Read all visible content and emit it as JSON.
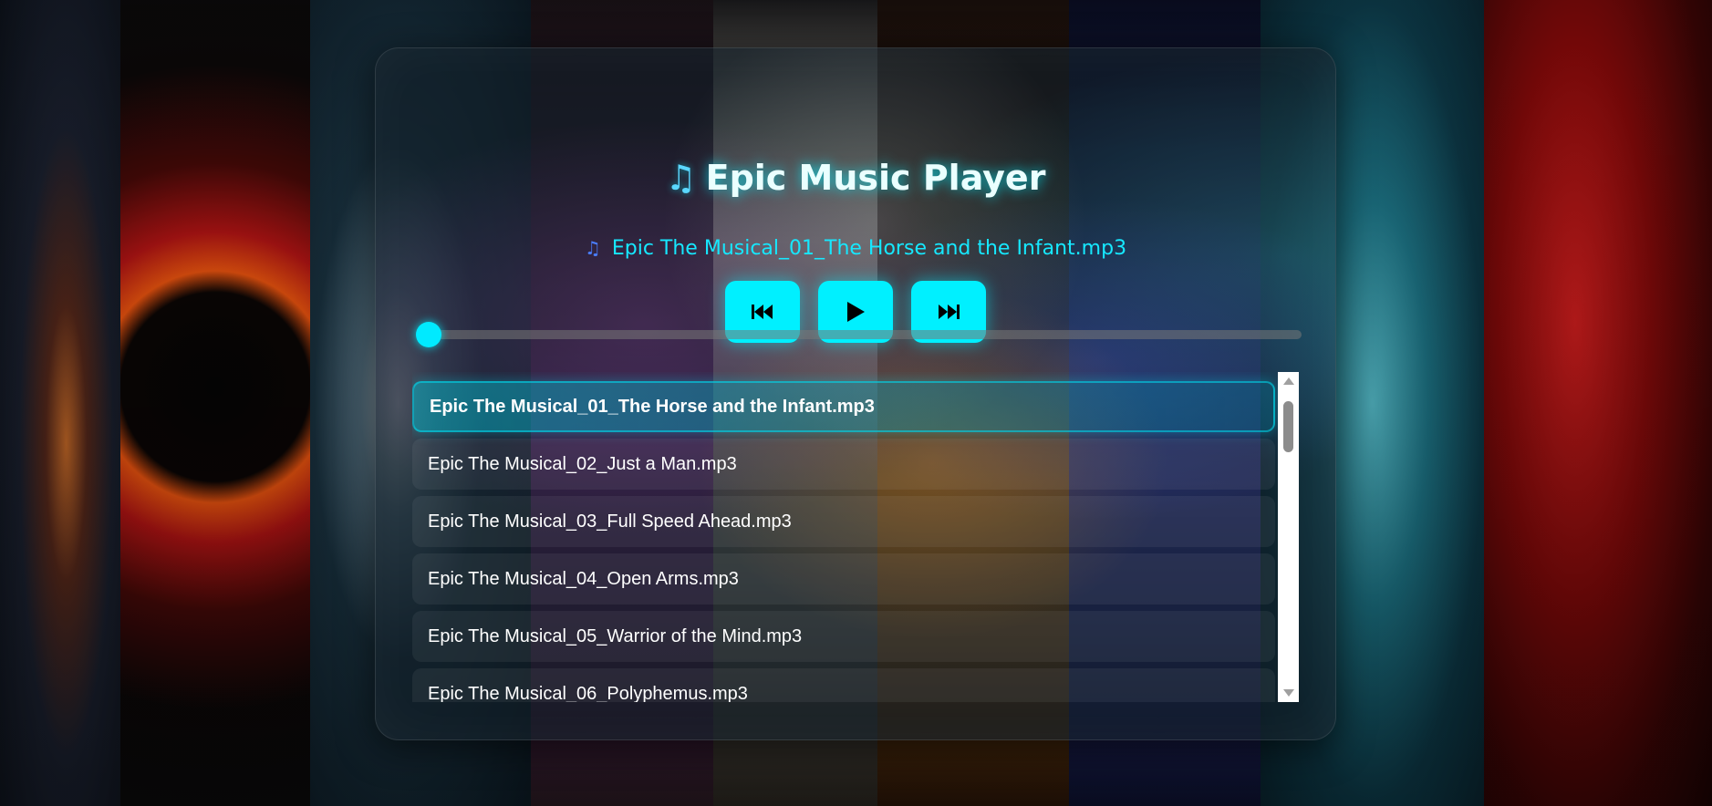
{
  "app": {
    "title_icon": "music-notes-icon",
    "title": "Epic Music Player"
  },
  "now_playing": {
    "icon": "music-note-icon",
    "track": "Epic The Musical_01_The Horse and the Infant.mp3"
  },
  "controls": {
    "previous": "previous-track-icon",
    "play": "play-icon",
    "next": "next-track-icon"
  },
  "progress": {
    "fraction": 0.0
  },
  "playlist": {
    "items": [
      "Epic The Musical_01_The Horse and the Infant.mp3",
      "Epic The Musical_02_Just a Man.mp3",
      "Epic The Musical_03_Full Speed Ahead.mp3",
      "Epic The Musical_04_Open Arms.mp3",
      "Epic The Musical_05_Warrior of the Mind.mp3",
      "Epic The Musical_06_Polyphemus.mp3"
    ],
    "active_index": 0
  },
  "colors": {
    "accent": "#00f0ff",
    "title_glow": "#00f0ff"
  }
}
